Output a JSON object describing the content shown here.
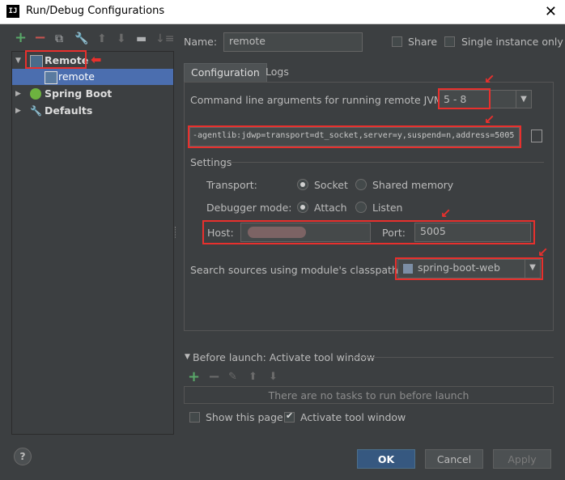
{
  "window": {
    "title": "Run/Debug Configurations",
    "app_icon": "IJ"
  },
  "toolbar": {
    "add": "+",
    "remove": "−"
  },
  "tree": {
    "items": [
      {
        "label": "Remote"
      },
      {
        "label": "remote"
      },
      {
        "label": "Spring Boot"
      },
      {
        "label": "Defaults"
      }
    ]
  },
  "name_field": {
    "label": "Name:",
    "value": "remote"
  },
  "share": {
    "label": "Share"
  },
  "single_instance": {
    "label": "Single instance only"
  },
  "tabs": [
    {
      "label": "Configuration"
    },
    {
      "label": "Logs"
    }
  ],
  "cmdline": {
    "label": "Command line arguments for running remote JVM",
    "jvm_version": "5 - 8",
    "args": "-agentlib:jdwp=transport=dt_socket,server=y,suspend=n,address=5005"
  },
  "settings": {
    "title": "Settings",
    "transport_label": "Transport:",
    "transport_socket": "Socket",
    "transport_shared": "Shared memory",
    "debugger_label": "Debugger mode:",
    "debugger_attach": "Attach",
    "debugger_listen": "Listen",
    "host_label": "Host:",
    "port_label": "Port:",
    "port_value": "5005"
  },
  "module": {
    "label": "Search sources using module's classpath:",
    "value": "spring-boot-web"
  },
  "before_launch": {
    "title": "Before launch: Activate tool window",
    "empty": "There are no tasks to run before launch",
    "show_page": "Show this page",
    "activate": "Activate tool window"
  },
  "buttons": {
    "ok": "OK",
    "cancel": "Cancel",
    "apply": "Apply",
    "help": "?"
  },
  "colors": {
    "accent": "#365880",
    "annotation": "#e8302d",
    "background": "#3c3f41"
  }
}
